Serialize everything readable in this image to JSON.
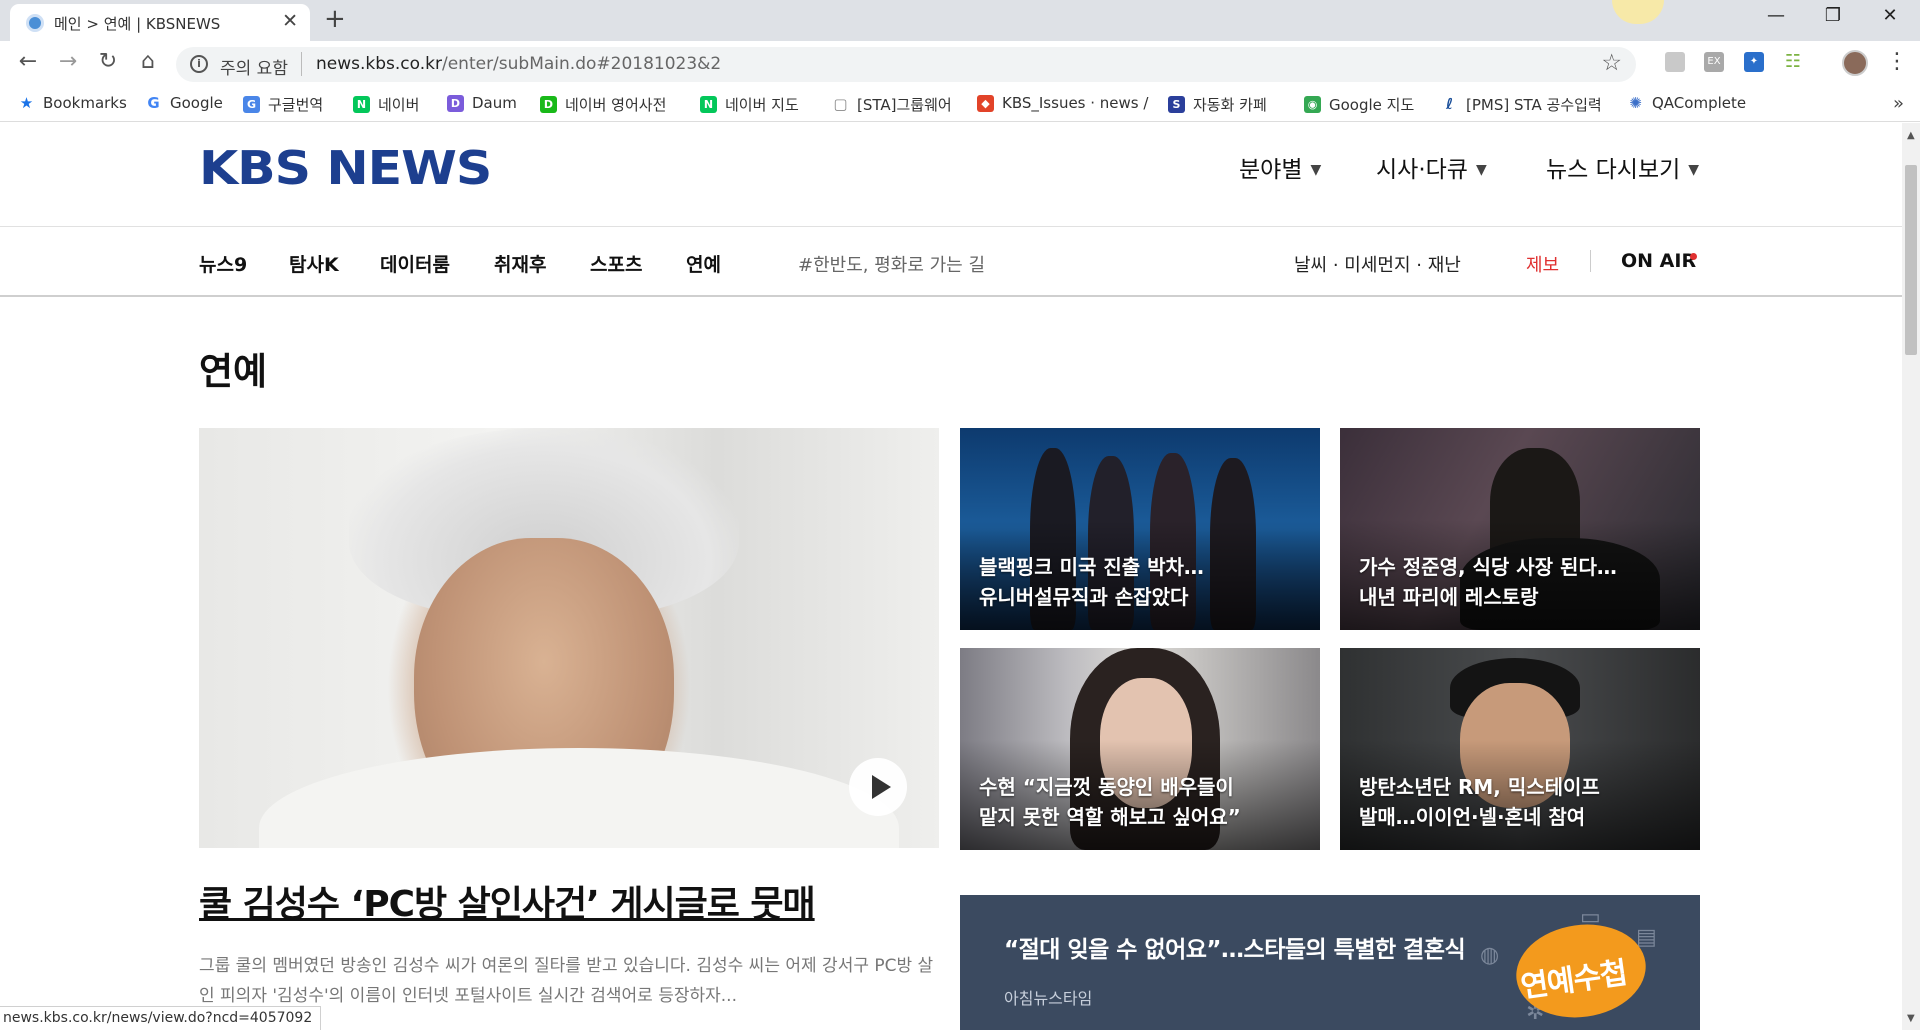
{
  "browser": {
    "tab_title": "메인 > 연예 | KBSNEWS",
    "tab_close": "✕",
    "new_tab": "+",
    "window_minimize": "—",
    "window_restore": "❐",
    "window_close": "✕",
    "security_label": "주의 요함",
    "url_host": "news.kbs.co.kr",
    "url_path": "/enter/subMain.do#20181023&2",
    "status_url": "news.kbs.co.kr/news/view.do?ncd=4057092"
  },
  "bookmarks": [
    {
      "label": "Bookmarks",
      "icon": "star-icon",
      "color": "#1a73e8"
    },
    {
      "label": "Google",
      "icon": "google-icon",
      "color": "#4285f4"
    },
    {
      "label": "구글번역",
      "icon": "translate-icon",
      "color": "#4a86e8"
    },
    {
      "label": "네이버",
      "icon": "naver-icon",
      "color": "#03c75a"
    },
    {
      "label": "Daum",
      "icon": "daum-icon",
      "color": "#7b5cdb"
    },
    {
      "label": "네이버 영어사전",
      "icon": "dict-icon",
      "color": "#19b919"
    },
    {
      "label": "네이버 지도",
      "icon": "naver-icon",
      "color": "#03c75a"
    },
    {
      "label": "[STA]그룹웨어",
      "icon": "page-icon",
      "color": "#888888"
    },
    {
      "label": "KBS_Issues · news /",
      "icon": "gitlab-icon",
      "color": "#e24329"
    },
    {
      "label": "자동화 카페",
      "icon": "sta-icon",
      "color": "#2b3f9b"
    },
    {
      "label": "Google 지도",
      "icon": "maps-icon",
      "color": "#34a853"
    },
    {
      "label": "[PMS] STA 공수입력",
      "icon": "pms-icon",
      "color": "#1b4f9a"
    },
    {
      "label": "QAComplete",
      "icon": "qa-icon",
      "color": "#3b6fc9"
    }
  ],
  "bookmarks_more": "»",
  "site": {
    "logo": "KBS NEWS",
    "main_nav": [
      "분야별",
      "시사·다큐",
      "뉴스 다시보기"
    ],
    "sub_nav": [
      "뉴스9",
      "탐사K",
      "데이터룸",
      "취재후",
      "스포츠",
      "연예"
    ],
    "tag_link": "#한반도, 평화로 가는 길",
    "weather_link": "날씨 · 미세먼지 · 재난",
    "report_link": "제보",
    "on_air": "ON AIR",
    "accent_red": "#e03131",
    "logo_color": "#1d3f8f"
  },
  "section": {
    "title": "연예"
  },
  "main_story": {
    "headline": "쿨 김성수 ‘PC방 살인사건’ 게시글로 뭇매",
    "summary": "그룹 쿨의 멤버였던 방송인 김성수 씨가 여론의 질타를 받고 있습니다. 김성수 씨는 어제 강서구 PC방 살인 피의자 '김성수'의 이름이 인터넷 포털사이트 실시간 검색어로 등장하자..."
  },
  "grid_stories": [
    {
      "line1": "블랙핑크 미국 진출 박차…",
      "line2": "유니버설뮤직과 손잡았다"
    },
    {
      "line1": "가수 정준영, 식당 사장 된다…",
      "line2": "내년 파리에 레스토랑"
    },
    {
      "line1": "수현 “지금껏 동양인 배우들이",
      "line2": "맡지 못한 역할 해보고 싶어요”"
    },
    {
      "line1": "방탄소년단 RM, 믹스테이프",
      "line2": "발매…이이언·넬·혼네 참여"
    }
  ],
  "promo": {
    "title": "“절대 잊을 수 없어요”…스타들의 특별한 결혼식",
    "subtitle": "아침뉴스타임",
    "badge": "연예수첩",
    "badge_color": "#f39a1d"
  }
}
